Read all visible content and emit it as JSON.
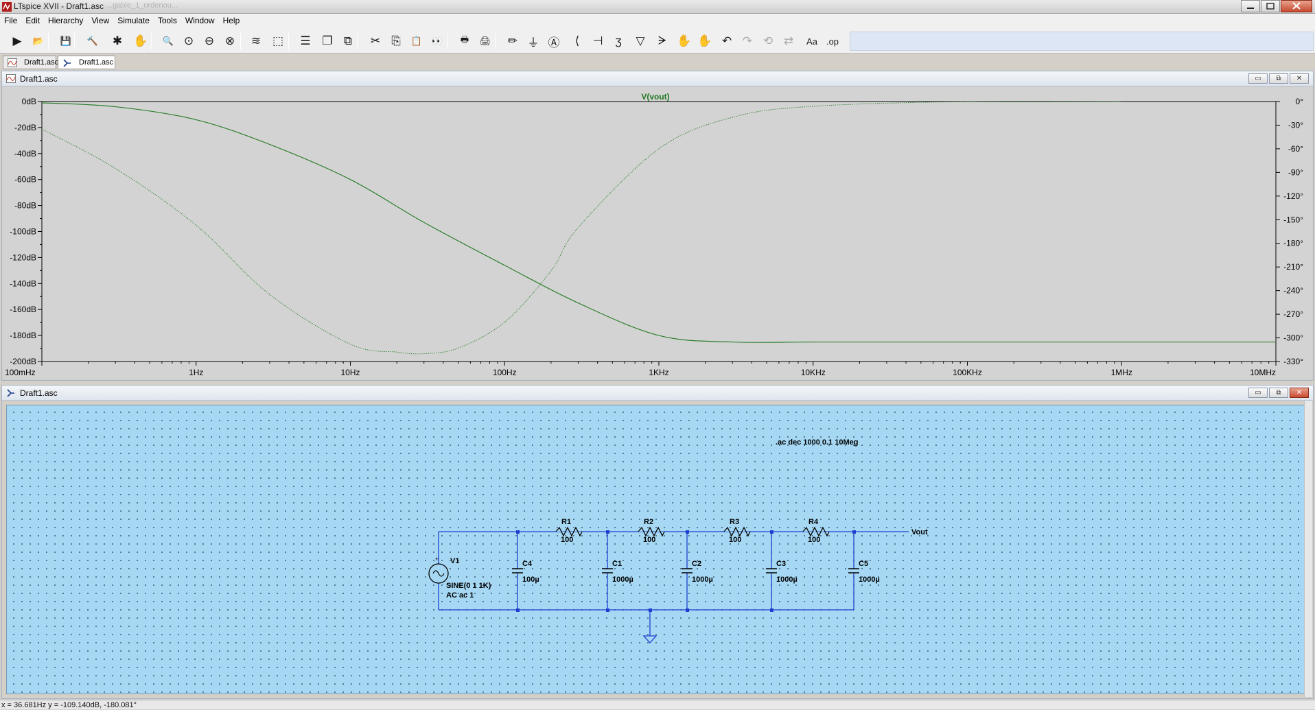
{
  "window": {
    "title": "LTspice XVII - Draft1.asc",
    "ghost_text": "...gable_1_ordenou..."
  },
  "menu": [
    "File",
    "Edit",
    "Hierarchy",
    "View",
    "Simulate",
    "Tools",
    "Window",
    "Help"
  ],
  "toolbar": [
    {
      "name": "run-icon",
      "glyph": "▶"
    },
    {
      "name": "open-folder-icon",
      "glyph": "📂"
    },
    {
      "name": "save-icon",
      "glyph": "💾"
    },
    {
      "name": "control-panel-icon",
      "glyph": "🔨"
    },
    {
      "name": "halt-icon",
      "glyph": "✱"
    },
    {
      "name": "pan-icon",
      "glyph": "✋"
    },
    {
      "name": "zoom-in-icon",
      "glyph": "🔍"
    },
    {
      "name": "zoom-full-icon",
      "glyph": "⊙"
    },
    {
      "name": "zoom-out-icon",
      "glyph": "⊖"
    },
    {
      "name": "zoom-cancel-icon",
      "glyph": "⊗"
    },
    {
      "name": "autorange-icon",
      "glyph": "≋"
    },
    {
      "name": "mark-unreferenced-icon",
      "glyph": "⬚"
    },
    {
      "name": "tile-horizontal-icon",
      "glyph": "☰"
    },
    {
      "name": "cascade-icon",
      "glyph": "❐"
    },
    {
      "name": "tile-vertical-icon",
      "glyph": "⧉"
    },
    {
      "name": "cut-icon",
      "glyph": "✂"
    },
    {
      "name": "copy-icon",
      "glyph": "⎘"
    },
    {
      "name": "paste-icon",
      "glyph": "📋"
    },
    {
      "name": "find-icon",
      "glyph": "👀"
    },
    {
      "name": "print-preview-icon",
      "glyph": "🖶"
    },
    {
      "name": "print-icon",
      "glyph": "🖨"
    },
    {
      "name": "draw-wire-icon",
      "glyph": "✏"
    },
    {
      "name": "ground-icon",
      "glyph": "⏚"
    },
    {
      "name": "label-net-icon",
      "glyph": "Ⓐ"
    },
    {
      "name": "resistor-icon",
      "glyph": "⟨"
    },
    {
      "name": "capacitor-icon",
      "glyph": "⊣"
    },
    {
      "name": "inductor-icon",
      "glyph": "ʒ"
    },
    {
      "name": "diode-icon",
      "glyph": "▽"
    },
    {
      "name": "component-icon",
      "glyph": "ᗒ"
    },
    {
      "name": "move-icon",
      "glyph": "✋"
    },
    {
      "name": "drag-icon",
      "glyph": "✋"
    },
    {
      "name": "undo-icon",
      "glyph": "↶"
    },
    {
      "name": "redo-icon",
      "glyph": "↷",
      "dim": true
    },
    {
      "name": "rotate-icon",
      "glyph": "⟲",
      "dim": true
    },
    {
      "name": "mirror-icon",
      "glyph": "⇄",
      "dim": true
    },
    {
      "name": "text-icon",
      "glyph": "Aa"
    },
    {
      "name": "spice-directive-icon",
      "glyph": ".op"
    }
  ],
  "doc_tabs": [
    {
      "label": "Draft1.asc",
      "kind": "waveform"
    },
    {
      "label": "Draft1.asc",
      "kind": "schematic",
      "active": true
    }
  ],
  "plot_window": {
    "title": "Draft1.asc"
  },
  "schematic_window": {
    "title": "Draft1.asc"
  },
  "mdi_controls": {
    "minimize": "▭",
    "restore": "⧉",
    "close": "✕"
  },
  "chart_data": {
    "type": "line",
    "title": "V(vout)",
    "x_scale": "log",
    "x_ticks": [
      "100mHz",
      "1Hz",
      "10Hz",
      "100Hz",
      "1KHz",
      "10KHz",
      "100KHz",
      "1MHz",
      "10MHz"
    ],
    "x_tick_values": [
      0.1,
      1,
      10,
      100,
      1000,
      10000,
      100000,
      1000000,
      10000000
    ],
    "xlim": [
      0.1,
      10000000
    ],
    "y_left_ticks": [
      "0dB",
      "-20dB",
      "-40dB",
      "-60dB",
      "-80dB",
      "-100dB",
      "-120dB",
      "-140dB",
      "-160dB",
      "-180dB",
      "-200dB"
    ],
    "ylim_left": [
      -200,
      0
    ],
    "y_right_ticks": [
      "0°",
      "-30°",
      "-60°",
      "-90°",
      "-120°",
      "-150°",
      "-180°",
      "-210°",
      "-240°",
      "-270°",
      "-300°",
      "-330°"
    ],
    "ylim_right": [
      -330,
      0
    ],
    "grid": false,
    "series": [
      {
        "name": "V(vout)",
        "kind": "magnitude",
        "axis": "left",
        "style": "solid",
        "x": [
          0.1,
          0.3,
          1,
          3,
          10,
          30,
          100,
          300,
          1000,
          3000,
          10000,
          100000,
          1000000,
          10000000
        ],
        "y": [
          -1,
          -4,
          -14,
          -33,
          -60,
          -93,
          -126,
          -155,
          -180,
          -185,
          -185,
          -185,
          -185,
          -185
        ]
      },
      {
        "name": "V(vout)",
        "kind": "phase",
        "axis": "right",
        "style": "dotted",
        "x": [
          0.1,
          0.3,
          1,
          3,
          10,
          20,
          30,
          50,
          100,
          200,
          300,
          1000,
          3000,
          10000,
          100000,
          1000000
        ],
        "y": [
          -35,
          -85,
          -157,
          -245,
          -308,
          -318,
          -320,
          -313,
          -280,
          -215,
          -160,
          -60,
          -20,
          -6,
          0,
          0
        ]
      }
    ]
  },
  "schematic": {
    "directive": ".ac dec 1000 0.1 10Meg",
    "net_label": "Vout",
    "source": {
      "name": "V1",
      "value1": "SINE(0 1 1K)",
      "value2": "AC ac 1"
    },
    "resistors": [
      {
        "name": "R1",
        "value": "100"
      },
      {
        "name": "R2",
        "value": "100"
      },
      {
        "name": "R3",
        "value": "100"
      },
      {
        "name": "R4",
        "value": "100"
      }
    ],
    "capacitors": [
      {
        "name": "C4",
        "value": "100µ"
      },
      {
        "name": "C1",
        "value": "1000µ"
      },
      {
        "name": "C2",
        "value": "1000µ"
      },
      {
        "name": "C3",
        "value": "1000µ"
      },
      {
        "name": "C5",
        "value": "1000µ"
      }
    ]
  },
  "status": {
    "text": "x = 36.681Hz    y = -109.140dB, -180.081°"
  }
}
